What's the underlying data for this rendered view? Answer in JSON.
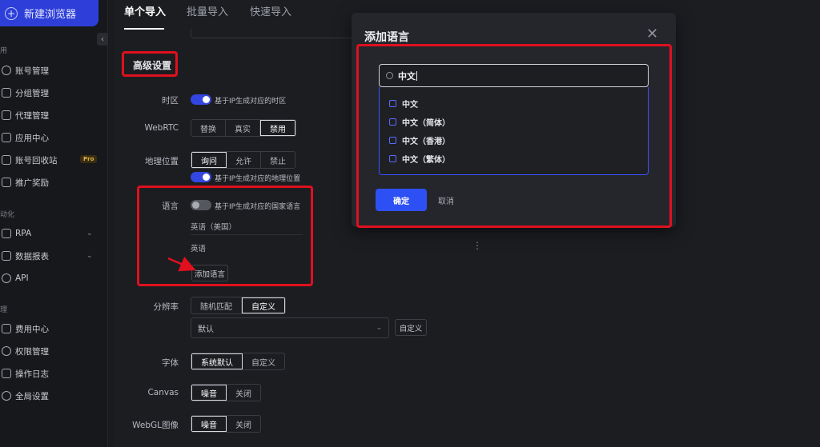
{
  "sidebar": {
    "new_browser": "新建浏览器",
    "section_general": "用",
    "section_automation": "动化",
    "section_manage": "理",
    "items": [
      {
        "label": "账号管理",
        "icon": "user-icon"
      },
      {
        "label": "分组管理",
        "icon": "folder-icon"
      },
      {
        "label": "代理管理",
        "icon": "proxy-icon"
      },
      {
        "label": "应用中心",
        "icon": "app-icon"
      },
      {
        "label": "账号回收站",
        "icon": "trash-icon",
        "badge": "Pro"
      },
      {
        "label": "推广奖励",
        "icon": "gift-icon"
      },
      {
        "label": "RPA",
        "icon": "rpa-icon"
      },
      {
        "label": "数据报表",
        "icon": "report-icon"
      },
      {
        "label": "API",
        "icon": "api-icon"
      },
      {
        "label": "费用中心",
        "icon": "wallet-icon"
      },
      {
        "label": "权限管理",
        "icon": "shield-icon"
      },
      {
        "label": "操作日志",
        "icon": "log-icon"
      },
      {
        "label": "全局设置",
        "icon": "gear-icon"
      }
    ]
  },
  "tabs": [
    "单个导入",
    "批量导入",
    "快速导入"
  ],
  "advanced": {
    "title": "高级设置",
    "timezone": {
      "label": "时区",
      "hint": "基于IP生成对应的时区"
    },
    "webrtc": {
      "label": "WebRTC",
      "options": [
        "替换",
        "真实",
        "禁用"
      ],
      "selected": "禁用"
    },
    "geo": {
      "label": "地理位置",
      "options": [
        "询问",
        "允许",
        "禁止"
      ],
      "selected": "询问",
      "hint": "基于IP生成对应的地理位置"
    },
    "language": {
      "label": "语言",
      "hint": "基于IP生成对应的国家语言",
      "items": [
        "英语（美国）",
        "英语"
      ],
      "add": "添加语言"
    },
    "resolution": {
      "label": "分辨率",
      "options": [
        "随机匹配",
        "自定义"
      ],
      "selected": "自定义",
      "select_value": "默认",
      "custom": "自定义"
    },
    "font": {
      "label": "字体",
      "options": [
        "系统默认",
        "自定义"
      ],
      "selected": "系统默认"
    },
    "canvas": {
      "label": "Canvas",
      "options": [
        "噪音",
        "关闭"
      ],
      "selected": "噪音"
    },
    "webgl": {
      "label": "WebGL图像",
      "options": [
        "噪音",
        "关闭"
      ],
      "selected": "噪音"
    }
  },
  "modal": {
    "title": "添加语言",
    "search_value": "中文",
    "options": [
      "中文",
      "中文（简体）",
      "中文（香港）",
      "中文（繁体）"
    ],
    "confirm": "确定",
    "cancel": "取消"
  },
  "colors": {
    "accent": "#2d50f5",
    "annotation": "#e0101f"
  }
}
